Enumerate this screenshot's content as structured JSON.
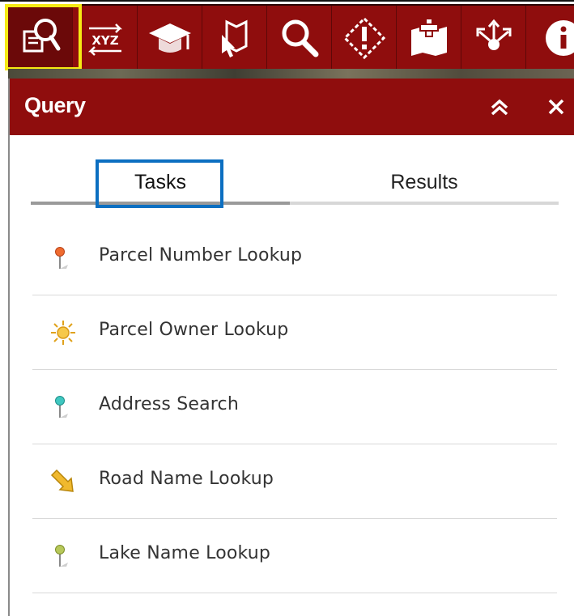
{
  "toolbar": {
    "tools": [
      {
        "icon": "query-icon",
        "active": true
      },
      {
        "icon": "coordinate-xyz-icon",
        "label": "XYZ"
      },
      {
        "icon": "graduation-cap-icon"
      },
      {
        "icon": "select-map-icon"
      },
      {
        "icon": "search-icon"
      },
      {
        "icon": "incident-alert-icon"
      },
      {
        "icon": "add-to-map-icon"
      },
      {
        "icon": "share-icon"
      },
      {
        "icon": "info-icon"
      }
    ]
  },
  "panel": {
    "title": "Query",
    "collapse_icon": "double-chevron-up-icon",
    "close_icon": "close-icon"
  },
  "tabs": [
    {
      "label": "Tasks",
      "selected": true
    },
    {
      "label": "Results",
      "selected": false
    }
  ],
  "tasks": [
    {
      "label": "Parcel Number Lookup",
      "icon": "pushpin-orange-icon"
    },
    {
      "label": "Parcel Owner Lookup",
      "icon": "sun-icon"
    },
    {
      "label": "Address Search",
      "icon": "pushpin-teal-icon"
    },
    {
      "label": "Road Name Lookup",
      "icon": "arrow-down-right-icon"
    },
    {
      "label": "Lake Name Lookup",
      "icon": "pushpin-green-icon"
    }
  ],
  "colors": {
    "brand": "#8f0d0d",
    "highlight": "#f5ea14",
    "focus": "#0c6fc1"
  }
}
